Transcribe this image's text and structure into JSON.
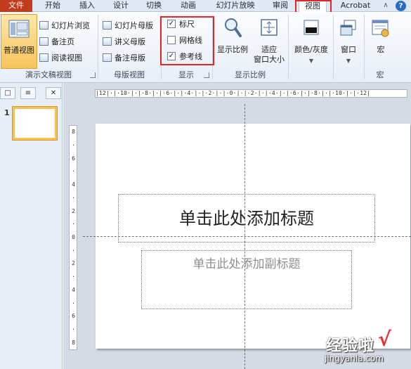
{
  "tabs": [
    "文件",
    "开始",
    "插入",
    "设计",
    "切换",
    "动画",
    "幻灯片放映",
    "审阅",
    "视图",
    "Acrobat"
  ],
  "active_tab": "视图",
  "ribbon": {
    "groups": {
      "presentation_views": {
        "label": "演示文稿视图",
        "normal_view": "普通视图",
        "slide_sorter": "幻灯片浏览",
        "notes_page": "备注页",
        "reading_view": "阅读视图"
      },
      "master_views": {
        "label": "母版视图",
        "slide_master": "幻灯片母版",
        "handout_master": "讲义母版",
        "notes_master": "备注母版"
      },
      "show": {
        "label": "显示",
        "ruler": {
          "label": "标尺",
          "checked": true
        },
        "gridlines": {
          "label": "网格线",
          "checked": false
        },
        "guides": {
          "label": "参考线",
          "checked": true
        }
      },
      "zoom": {
        "label": "显示比例",
        "zoom_btn": "显示比例",
        "fit_line1": "适应",
        "fit_line2": "窗口大小"
      },
      "color": {
        "label": "颜色/灰度"
      },
      "window": {
        "label": "窗口"
      },
      "macros": {
        "btn": "宏",
        "label": "宏"
      }
    }
  },
  "left_pane": {
    "slide_number": "1"
  },
  "ruler": {
    "horizontal": "|12|·|·10·|·|·8·|·|·6·|·|·4·|·|·2·|·|·0·|·|·2·|·|·4·|·|·6·|·|·8·|·|·10·|·|·12|",
    "vertical": [
      "8",
      "·",
      "6",
      "·",
      "4",
      "·",
      "2",
      "·",
      "0",
      "·",
      "2",
      "·",
      "4",
      "·",
      "6",
      "·",
      "8"
    ]
  },
  "slide": {
    "title_placeholder": "单击此处添加标题",
    "subtitle_placeholder": "单击此处添加副标题"
  },
  "watermark": {
    "main": "经验啦",
    "check": "√",
    "url": "jingyanla.com"
  },
  "colors": {
    "file_tab": "#c23b1d",
    "highlight": "#e0262b",
    "thumb_border": "#f5c25a"
  }
}
